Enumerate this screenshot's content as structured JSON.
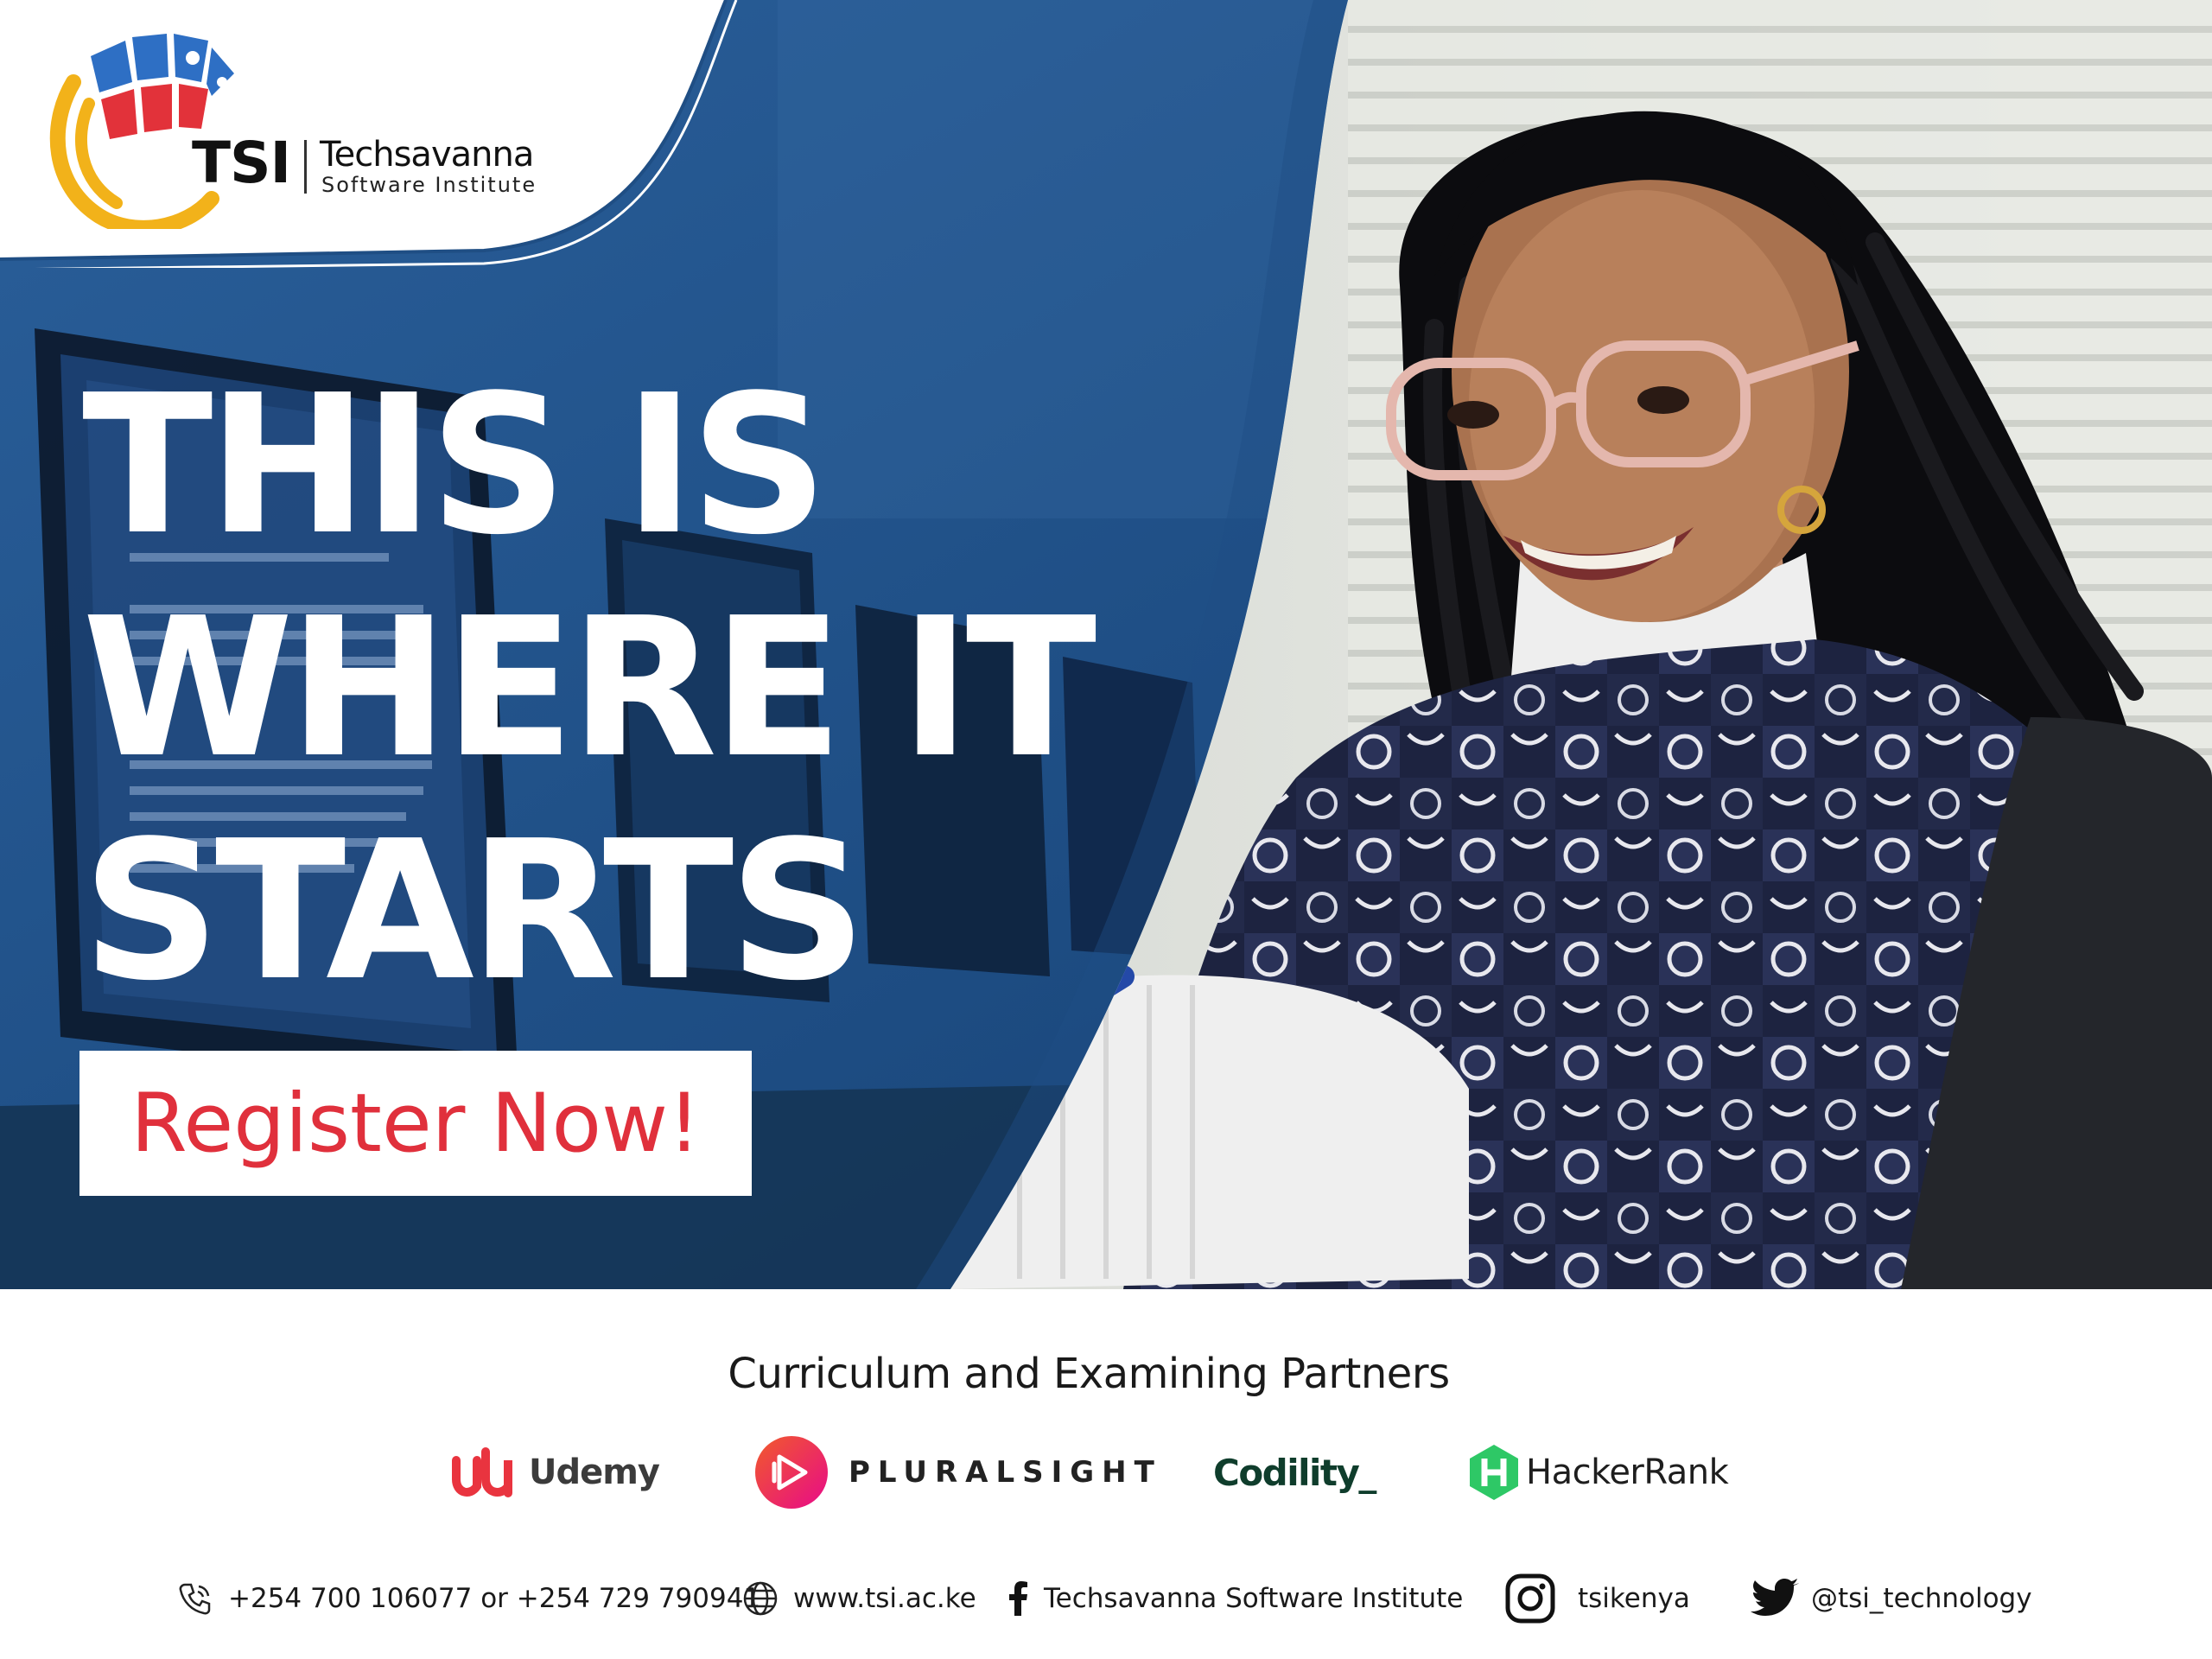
{
  "brand": {
    "abbr": "TSI",
    "name": "Techsavanna",
    "subtitle": "Software Institute"
  },
  "hero": {
    "headline": [
      "THIS IS",
      "WHERE IT",
      "STARTS"
    ],
    "cta_label": "Register Now!"
  },
  "partners": {
    "title": "Curriculum and Examining Partners",
    "items": [
      {
        "name": "Udemy",
        "icon": "udemy-logo-icon",
        "color": "#e9343f"
      },
      {
        "name": "PLURALSIGHT",
        "icon": "pluralsight-logo-icon",
        "color": "#e80a89"
      },
      {
        "name": "Codility_",
        "icon": "codility-logo",
        "color": "#0f3d2c"
      },
      {
        "name": "HackerRank",
        "icon": "hackerrank-logo-icon",
        "color": "#2ec866"
      }
    ]
  },
  "contacts": {
    "phone": "+254 700 106077 or +254 729 790941",
    "website": "www.tsi.ac.ke",
    "facebook": "Techsavanna Software Institute",
    "instagram": "tsikenya",
    "twitter": "@tsi_technology"
  },
  "colors": {
    "hero_blue": "#1f4e84",
    "cta_red": "#e0303c",
    "logo_blue": "#2e6fc4",
    "logo_red": "#e2323a",
    "logo_yellow": "#f2b21a"
  }
}
